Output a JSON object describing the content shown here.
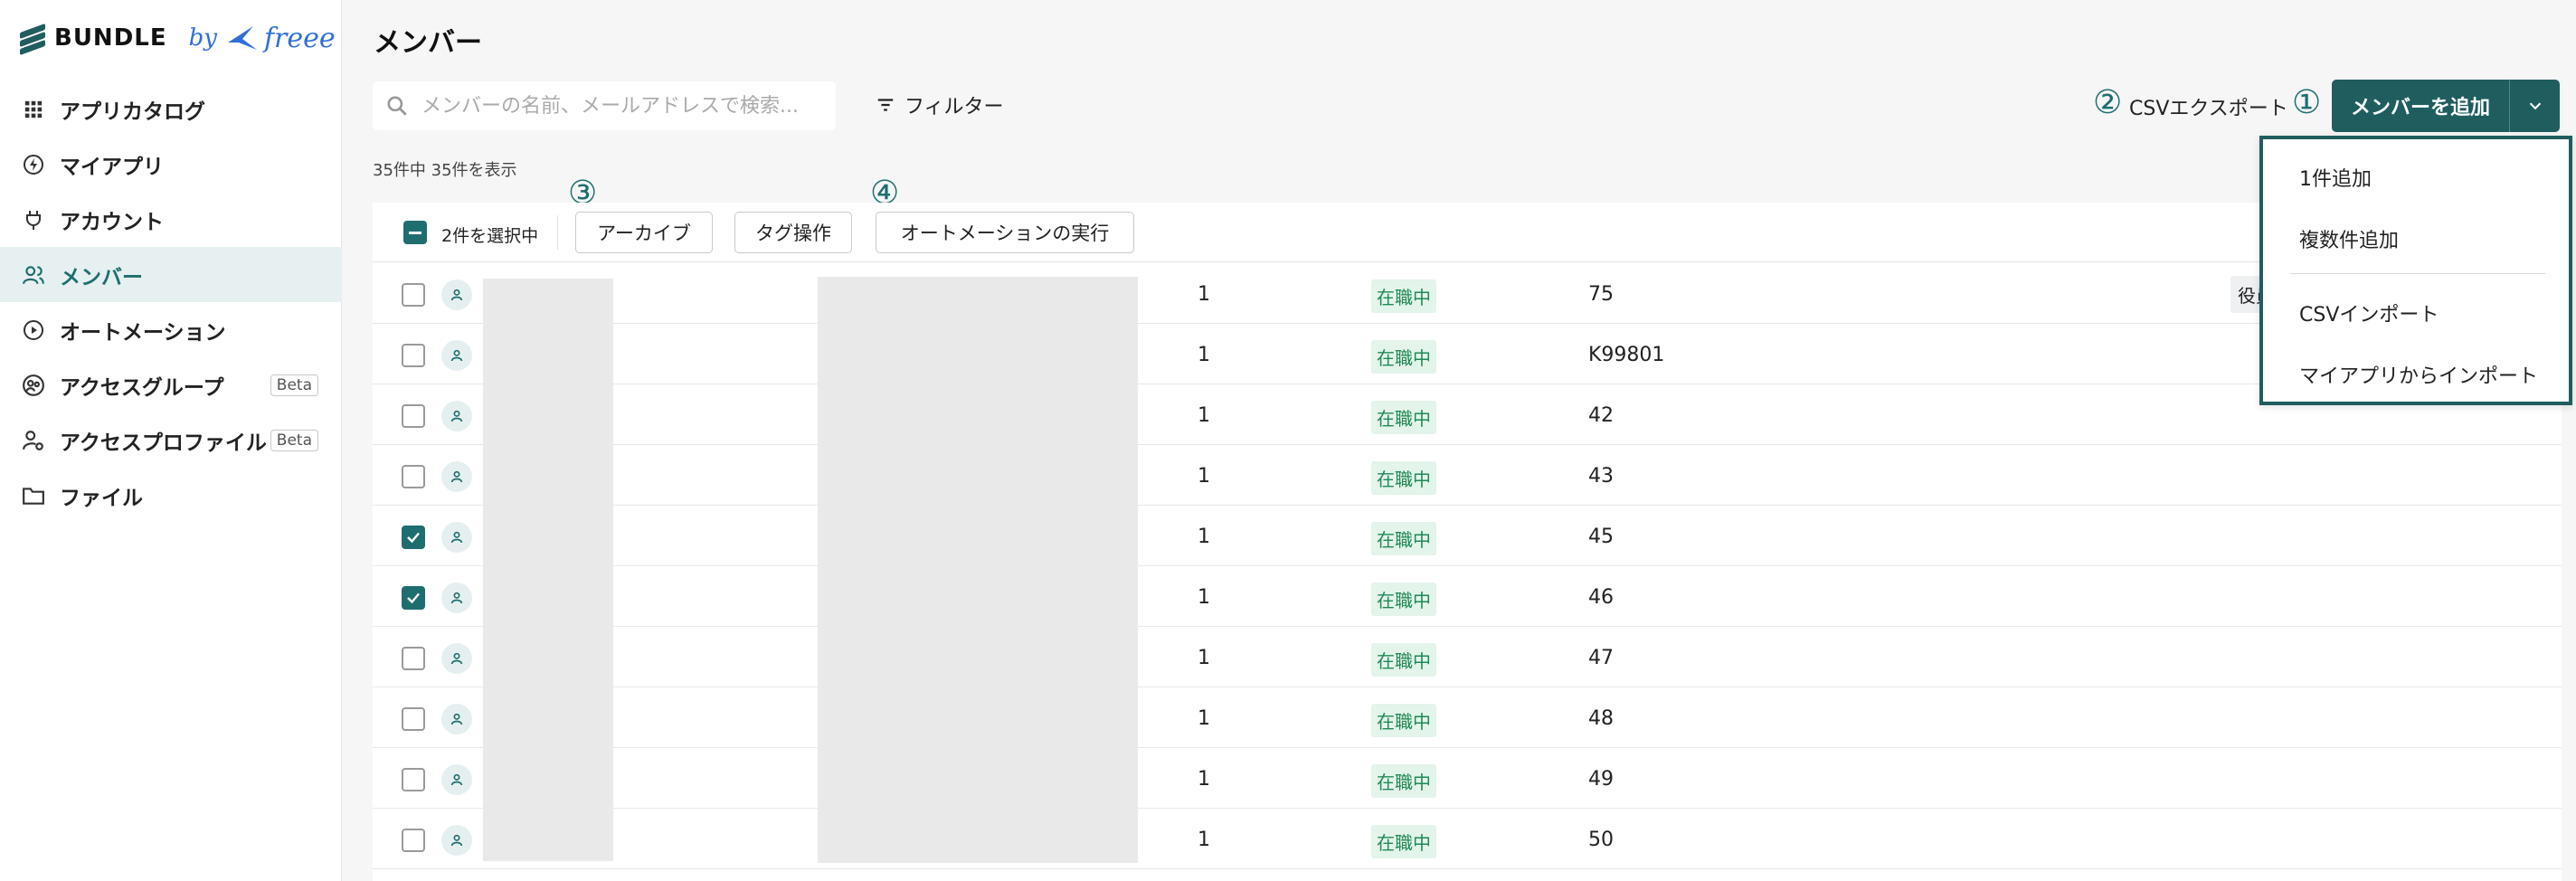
{
  "brand": {
    "name": "BUNDLE",
    "by": "by",
    "partner": "freee"
  },
  "sidebar": {
    "items": [
      {
        "label": "アプリカタログ",
        "icon": "grid-icon",
        "active": false
      },
      {
        "label": "マイアプリ",
        "icon": "bolt-icon",
        "active": false
      },
      {
        "label": "アカウント",
        "icon": "plug-icon",
        "active": false
      },
      {
        "label": "メンバー",
        "icon": "users-icon",
        "active": true
      },
      {
        "label": "オートメーション",
        "icon": "play-circle-icon",
        "active": false
      },
      {
        "label": "アクセスグループ",
        "icon": "group-icon",
        "active": false,
        "badge": "Beta"
      },
      {
        "label": "アクセスプロファイル",
        "icon": "user-gear-icon",
        "active": false,
        "badge": "Beta"
      },
      {
        "label": "ファイル",
        "icon": "folder-icon",
        "active": false
      }
    ]
  },
  "header": {
    "title": "メンバー"
  },
  "search": {
    "placeholder": "メンバーの名前、メールアドレスで検索..."
  },
  "filter": {
    "label": "フィルター"
  },
  "annotations": {
    "one": "①",
    "two": "②",
    "three": "③",
    "four": "④"
  },
  "actions": {
    "csv_export": "CSVエクスポート",
    "add_member": "メンバーを追加"
  },
  "summary": {
    "count": "35件中 35件を表示"
  },
  "toolbar": {
    "selected": "2件を選択中",
    "archive": "アーカイブ",
    "tags": "タグ操作",
    "automation": "オートメーションの実行"
  },
  "rows": [
    {
      "checked": false,
      "num": "1",
      "status": "在職中",
      "id": "75",
      "role": "役員"
    },
    {
      "checked": false,
      "num": "1",
      "status": "在職中",
      "id": "K99801"
    },
    {
      "checked": false,
      "num": "1",
      "status": "在職中",
      "id": "42"
    },
    {
      "checked": false,
      "num": "1",
      "status": "在職中",
      "id": "43"
    },
    {
      "checked": true,
      "num": "1",
      "status": "在職中",
      "id": "45"
    },
    {
      "checked": true,
      "num": "1",
      "status": "在職中",
      "id": "46"
    },
    {
      "checked": false,
      "num": "1",
      "status": "在職中",
      "id": "47"
    },
    {
      "checked": false,
      "num": "1",
      "status": "在職中",
      "id": "48"
    },
    {
      "checked": false,
      "num": "1",
      "status": "在職中",
      "id": "49"
    },
    {
      "checked": false,
      "num": "1",
      "status": "在職中",
      "id": "50"
    }
  ],
  "dropdown": {
    "items": [
      "1件追加",
      "複数件追加",
      "CSVインポート",
      "マイアプリからインポート"
    ]
  },
  "colors": {
    "primary": "#1f5d5f",
    "accent": "#1f6e6f",
    "status_green": "#1f8a55",
    "brand_blue": "#2f6fd8"
  }
}
